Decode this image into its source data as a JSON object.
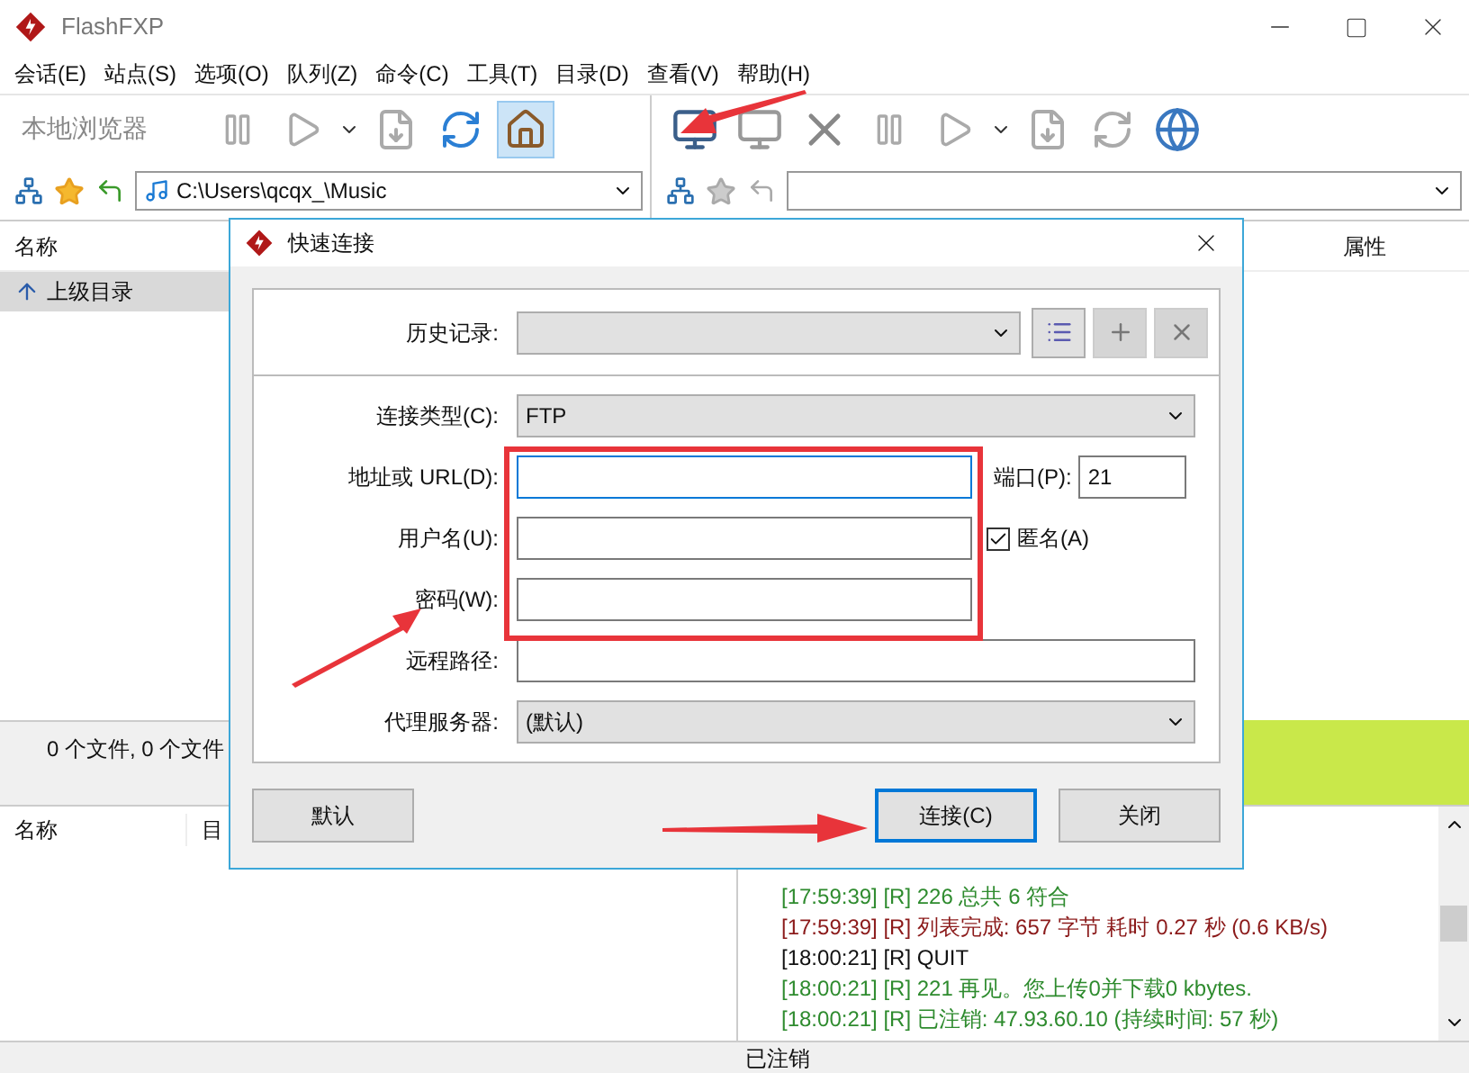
{
  "window": {
    "title": "FlashFXP"
  },
  "menu": [
    "会话(E)",
    "站点(S)",
    "选项(O)",
    "队列(Z)",
    "命令(C)",
    "工具(T)",
    "目录(D)",
    "查看(V)",
    "帮助(H)"
  ],
  "local_toolbar": {
    "label": "本地浏览器"
  },
  "local_path": "C:\\Users\\qcqx_\\Music",
  "left_pane": {
    "columns": [
      "名称"
    ],
    "rows": [
      {
        "name": "上级目录",
        "selected": true
      }
    ],
    "status": "0 个文件, 0 个文件"
  },
  "right_pane": {
    "columns": [
      "属性"
    ]
  },
  "queue": {
    "columns": [
      "名称",
      "目"
    ]
  },
  "log": [
    {
      "text": "[17:59:39]  [R] 226 总共 6 符合",
      "color": "#2e8b2e"
    },
    {
      "text": "[17:59:39]  [R] 列表完成: 657 字节 耗时 0.27 秒 (0.6 KB/s)",
      "color": "#8b1a1a"
    },
    {
      "text": "[18:00:21]  [R] QUIT",
      "color": "#111111"
    },
    {
      "text": "[18:00:21]  [R] 221 再见。您上传0并下载0 kbytes.",
      "color": "#2e8b2e"
    },
    {
      "text": "[18:00:21]  [R] 已注销: 47.93.60.10 (持续时间: 57 秒)",
      "color": "#2e8b2e"
    }
  ],
  "status_bar": "已注销",
  "dialog": {
    "title": "快速连接",
    "history": {
      "label": "历史记录:"
    },
    "fields": [
      {
        "kind": "combo",
        "label": "连接类型(C):",
        "value": "FTP"
      },
      {
        "kind": "input",
        "label": "地址或 URL(D):",
        "focused": true
      },
      {
        "kind": "input",
        "label": "用户名(U):",
        "focused": false
      },
      {
        "kind": "input",
        "label": "密码(W):",
        "focused": false
      },
      {
        "kind": "input",
        "label": "远程路径:",
        "focused": false
      },
      {
        "kind": "combo",
        "label": "代理服务器:",
        "value": "(默认)"
      }
    ],
    "port": {
      "label": "端口(P):",
      "value": "21"
    },
    "anonymous": {
      "label": "匿名(A)",
      "checked": true
    },
    "buttons": [
      {
        "label": "默认",
        "selected": false
      },
      {
        "label": "连接(C)",
        "selected": true
      },
      {
        "label": "关闭",
        "selected": false
      }
    ]
  }
}
